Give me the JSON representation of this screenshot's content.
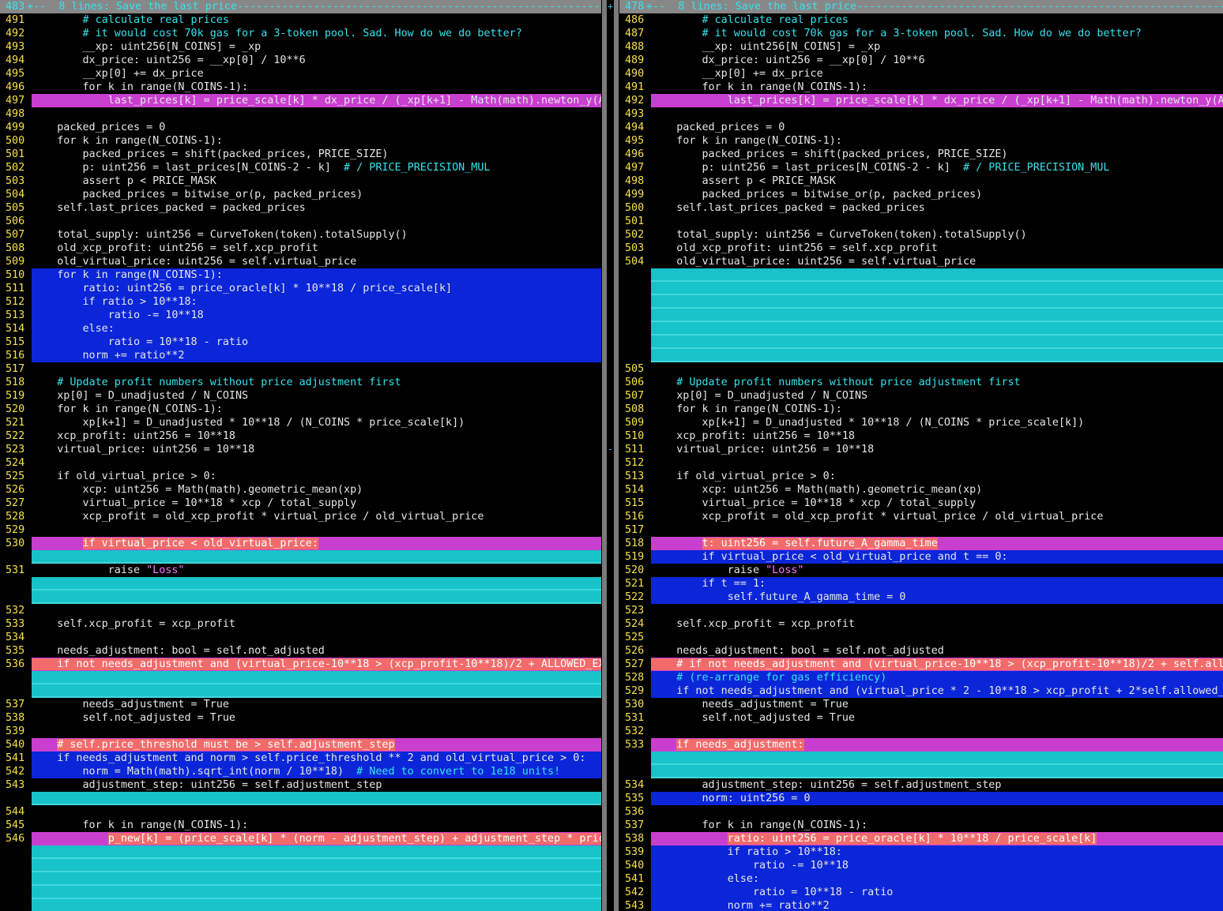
{
  "left": {
    "lines": [
      {
        "n": "483",
        "t": "+--  8 lines: Save the last price----------------------------------------------------------------",
        "k": "fold"
      },
      {
        "n": "491",
        "t": "        # calculate real prices",
        "k": "c"
      },
      {
        "n": "492",
        "t": "        # it would cost 70k gas for a 3-token pool. Sad. How do we do better?",
        "k": "c"
      },
      {
        "n": "493",
        "t": "        __xp: uint256[N_COINS] = _xp"
      },
      {
        "n": "494",
        "t": "        dx_price: uint256 = __xp[0] / 10**6"
      },
      {
        "n": "495",
        "t": "        __xp[0] += dx_price"
      },
      {
        "n": "496",
        "t": "        for k in range(N_COINS-1):"
      },
      {
        "n": "497",
        "t": "            last_prices[k] = price_scale[k] * dx_price / (_xp[k+1] - Math(math).newton_y(A",
        "k": "chg"
      },
      {
        "n": "498",
        "t": ""
      },
      {
        "n": "499",
        "t": "    packed_prices = 0"
      },
      {
        "n": "500",
        "t": "    for k in range(N_COINS-1):"
      },
      {
        "n": "501",
        "t": "        packed_prices = shift(packed_prices, PRICE_SIZE)"
      },
      {
        "n": "502",
        "t": "        p: uint256 = last_prices[N_COINS-2 - k]  ",
        "cm": "# / PRICE_PRECISION_MUL"
      },
      {
        "n": "503",
        "t": "        assert p < PRICE_MASK"
      },
      {
        "n": "504",
        "t": "        packed_prices = bitwise_or(p, packed_prices)"
      },
      {
        "n": "505",
        "t": "    self.last_prices_packed = packed_prices"
      },
      {
        "n": "506",
        "t": ""
      },
      {
        "n": "507",
        "t": "    total_supply: uint256 = CurveToken(token).totalSupply()"
      },
      {
        "n": "508",
        "t": "    old_xcp_profit: uint256 = self.xcp_profit"
      },
      {
        "n": "509",
        "t": "    old_virtual_price: uint256 = self.virtual_price"
      },
      {
        "n": "510",
        "t": "    for k in range(N_COINS-1):",
        "k": "add"
      },
      {
        "n": "511",
        "t": "        ratio: uint256 = price_oracle[k] * 10**18 / price_scale[k]",
        "k": "add"
      },
      {
        "n": "512",
        "t": "        if ratio > 10**18:",
        "k": "add"
      },
      {
        "n": "513",
        "t": "            ratio -= 10**18",
        "k": "add"
      },
      {
        "n": "514",
        "t": "        else:",
        "k": "add"
      },
      {
        "n": "515",
        "t": "            ratio = 10**18 - ratio",
        "k": "add"
      },
      {
        "n": "516",
        "t": "        norm += ratio**2",
        "k": "add"
      },
      {
        "n": "517",
        "t": ""
      },
      {
        "n": "518",
        "t": "    # Update profit numbers without price adjustment first",
        "k": "c"
      },
      {
        "n": "519",
        "t": "    xp[0] = D_unadjusted / N_COINS"
      },
      {
        "n": "520",
        "t": "    for k in range(N_COINS-1):"
      },
      {
        "n": "521",
        "t": "        xp[k+1] = D_unadjusted * 10**18 / (N_COINS * price_scale[k])"
      },
      {
        "n": "522",
        "t": "    xcp_profit: uint256 = 10**18"
      },
      {
        "n": "523",
        "t": "    virtual_price: uint256 = 10**18"
      },
      {
        "n": "524",
        "t": ""
      },
      {
        "n": "525",
        "t": "    if old_virtual_price > 0:"
      },
      {
        "n": "526",
        "t": "        xcp: uint256 = Math(math).geometric_mean(xp)"
      },
      {
        "n": "527",
        "t": "        virtual_price = 10**18 * xcp / total_supply"
      },
      {
        "n": "528",
        "t": "        xcp_profit = old_xcp_profit * virtual_price / old_virtual_price"
      },
      {
        "n": "529",
        "t": ""
      },
      {
        "n": "530",
        "t": "        ",
        "hl": "if virtual_price < old_virtual_price:",
        "k": "chg"
      },
      {
        "n": "",
        "t": "",
        "k": "fill"
      },
      {
        "n": "531",
        "t": "            raise ",
        "st": "\"Loss\""
      },
      {
        "n": "",
        "t": "",
        "k": "fill"
      },
      {
        "n": "",
        "t": "",
        "k": "fill"
      },
      {
        "n": "532",
        "t": ""
      },
      {
        "n": "533",
        "t": "    self.xcp_profit = xcp_profit"
      },
      {
        "n": "534",
        "t": ""
      },
      {
        "n": "535",
        "t": "    needs_adjustment: bool = self.not_adjusted"
      },
      {
        "n": "536",
        "t": "",
        "hl": "    if not needs_adjustment and (virtual_price-10**18 > (xcp_profit-10**18)/2 + ALLOWED_EX",
        "k": "chg"
      },
      {
        "n": "",
        "t": "",
        "k": "fill"
      },
      {
        "n": "",
        "t": "",
        "k": "fill"
      },
      {
        "n": "537",
        "t": "        needs_adjustment = True"
      },
      {
        "n": "538",
        "t": "        self.not_adjusted = True"
      },
      {
        "n": "539",
        "t": ""
      },
      {
        "n": "540",
        "t": "    ",
        "hl": "# self.price_threshold must be > self.adjustment_step",
        "k": "chg"
      },
      {
        "n": "541",
        "t": "    if needs_adjustment and norm > self.price_threshold ** 2 and old_virtual_price > 0:",
        "k": "add"
      },
      {
        "n": "542",
        "t": "        norm = Math(math).sqrt_int(norm / 10**18)  ",
        "cm": "# Need to convert to 1e18 units!",
        "k": "add"
      },
      {
        "n": "543",
        "t": "        adjustment_step: uint256 = self.adjustment_step"
      },
      {
        "n": "",
        "t": "",
        "k": "fill"
      },
      {
        "n": "544",
        "t": ""
      },
      {
        "n": "545",
        "t": "        for k in range(N_COINS-1):"
      },
      {
        "n": "546",
        "t": "            ",
        "hl": "p_new[k] = (price_scale[k] * (norm - adjustment_step) + adjustment_step * pric",
        "k": "chg"
      },
      {
        "n": "",
        "t": "",
        "k": "fill"
      },
      {
        "n": "",
        "t": "",
        "k": "fill"
      },
      {
        "n": "",
        "t": "",
        "k": "fill"
      },
      {
        "n": "",
        "t": "",
        "k": "fill"
      },
      {
        "n": "",
        "t": "",
        "k": "fill"
      }
    ]
  },
  "right": {
    "lines": [
      {
        "n": "478",
        "t": "+--  8 lines: Save the last price----------------------------------------------------------------",
        "k": "fold"
      },
      {
        "n": "486",
        "t": "        # calculate real prices",
        "k": "c"
      },
      {
        "n": "487",
        "t": "        # it would cost 70k gas for a 3-token pool. Sad. How do we do better?",
        "k": "c"
      },
      {
        "n": "488",
        "t": "        __xp: uint256[N_COINS] = _xp"
      },
      {
        "n": "489",
        "t": "        dx_price: uint256 = __xp[0] / 10**6"
      },
      {
        "n": "490",
        "t": "        __xp[0] += dx_price"
      },
      {
        "n": "491",
        "t": "        for k in range(N_COINS-1):"
      },
      {
        "n": "492",
        "t": "            last_prices[k] = price_scale[k] * dx_price / (_xp[k+1] - Math(math).newton_y(A",
        "k": "chg"
      },
      {
        "n": "493",
        "t": ""
      },
      {
        "n": "494",
        "t": "    packed_prices = 0"
      },
      {
        "n": "495",
        "t": "    for k in range(N_COINS-1):"
      },
      {
        "n": "496",
        "t": "        packed_prices = shift(packed_prices, PRICE_SIZE)"
      },
      {
        "n": "497",
        "t": "        p: uint256 = last_prices[N_COINS-2 - k]  ",
        "cm": "# / PRICE_PRECISION_MUL"
      },
      {
        "n": "498",
        "t": "        assert p < PRICE_MASK"
      },
      {
        "n": "499",
        "t": "        packed_prices = bitwise_or(p, packed_prices)"
      },
      {
        "n": "500",
        "t": "    self.last_prices_packed = packed_prices"
      },
      {
        "n": "501",
        "t": ""
      },
      {
        "n": "502",
        "t": "    total_supply: uint256 = CurveToken(token).totalSupply()"
      },
      {
        "n": "503",
        "t": "    old_xcp_profit: uint256 = self.xcp_profit"
      },
      {
        "n": "504",
        "t": "    old_virtual_price: uint256 = self.virtual_price"
      },
      {
        "n": "",
        "t": "",
        "k": "fill"
      },
      {
        "n": "",
        "t": "",
        "k": "fill"
      },
      {
        "n": "",
        "t": "",
        "k": "fill"
      },
      {
        "n": "",
        "t": "",
        "k": "fill"
      },
      {
        "n": "",
        "t": "",
        "k": "fill"
      },
      {
        "n": "",
        "t": "",
        "k": "fill"
      },
      {
        "n": "",
        "t": "",
        "k": "fill"
      },
      {
        "n": "505",
        "t": ""
      },
      {
        "n": "506",
        "t": "    # Update profit numbers without price adjustment first",
        "k": "c"
      },
      {
        "n": "507",
        "t": "    xp[0] = D_unadjusted / N_COINS"
      },
      {
        "n": "508",
        "t": "    for k in range(N_COINS-1):"
      },
      {
        "n": "509",
        "t": "        xp[k+1] = D_unadjusted * 10**18 / (N_COINS * price_scale[k])"
      },
      {
        "n": "510",
        "t": "    xcp_profit: uint256 = 10**18"
      },
      {
        "n": "511",
        "t": "    virtual_price: uint256 = 10**18"
      },
      {
        "n": "512",
        "t": ""
      },
      {
        "n": "513",
        "t": "    if old_virtual_price > 0:"
      },
      {
        "n": "514",
        "t": "        xcp: uint256 = Math(math).geometric_mean(xp)"
      },
      {
        "n": "515",
        "t": "        virtual_price = 10**18 * xcp / total_supply"
      },
      {
        "n": "516",
        "t": "        xcp_profit = old_xcp_profit * virtual_price / old_virtual_price"
      },
      {
        "n": "517",
        "t": ""
      },
      {
        "n": "518",
        "t": "        ",
        "hl": "t: uint256 = self.future_A_gamma_time",
        "k": "chg"
      },
      {
        "n": "519",
        "t": "        if virtual_price < old_virtual_price and t == 0:",
        "k": "add"
      },
      {
        "n": "520",
        "t": "            raise ",
        "st": "\"Loss\""
      },
      {
        "n": "521",
        "t": "        if t == 1:",
        "k": "add"
      },
      {
        "n": "522",
        "t": "            self.future_A_gamma_time = 0",
        "k": "add"
      },
      {
        "n": "523",
        "t": ""
      },
      {
        "n": "524",
        "t": "    self.xcp_profit = xcp_profit"
      },
      {
        "n": "525",
        "t": ""
      },
      {
        "n": "526",
        "t": "    needs_adjustment: bool = self.not_adjusted"
      },
      {
        "n": "527",
        "t": "",
        "hl": "    # if not needs_adjustment and (virtual_price-10**18 > (xcp_profit-10**18)/2 + self.all",
        "k": "chg"
      },
      {
        "n": "528",
        "t": "    # (re-arrange for gas efficiency)",
        "k": "addc"
      },
      {
        "n": "529",
        "t": "    if not needs_adjustment and (virtual_price * 2 - 10**18 > xcp_profit + 2*self.allowed_",
        "k": "add"
      },
      {
        "n": "530",
        "t": "        needs_adjustment = True"
      },
      {
        "n": "531",
        "t": "        self.not_adjusted = True"
      },
      {
        "n": "532",
        "t": ""
      },
      {
        "n": "533",
        "t": "    ",
        "hl": "if needs_adjustment:",
        "k": "chg"
      },
      {
        "n": "",
        "t": "",
        "k": "fill"
      },
      {
        "n": "",
        "t": "",
        "k": "fill"
      },
      {
        "n": "534",
        "t": "        adjustment_step: uint256 = self.adjustment_step"
      },
      {
        "n": "535",
        "t": "        norm: uint256 = 0",
        "k": "add"
      },
      {
        "n": "536",
        "t": ""
      },
      {
        "n": "537",
        "t": "        for k in range(N_COINS-1):"
      },
      {
        "n": "538",
        "t": "            ",
        "hl": "ratio: uint256 = price_oracle[k] * 10**18 / price_scale[k]",
        "k": "chg"
      },
      {
        "n": "539",
        "t": "            if ratio > 10**18:",
        "k": "add"
      },
      {
        "n": "540",
        "t": "                ratio -= 10**18",
        "k": "add"
      },
      {
        "n": "541",
        "t": "            else:",
        "k": "add"
      },
      {
        "n": "542",
        "t": "                ratio = 10**18 - ratio",
        "k": "add"
      },
      {
        "n": "543",
        "t": "            norm += ratio**2",
        "k": "add"
      }
    ]
  },
  "separator": {
    "top_mark": "+",
    "mid_mark": "-"
  }
}
